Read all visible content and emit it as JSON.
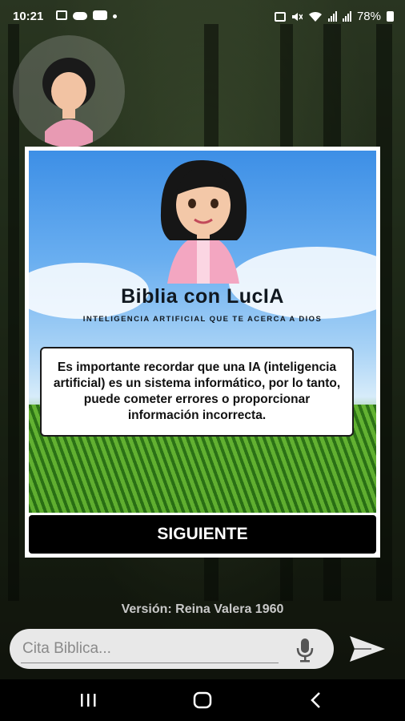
{
  "status_bar": {
    "time": "10:21",
    "battery": "78%",
    "left_icons": [
      "gallery-icon",
      "cloud-icon",
      "youtube-icon",
      "dot-icon"
    ],
    "right_icons": [
      "alarm-icon",
      "mute-icon",
      "wifi-icon",
      "signal-icon",
      "signal-icon-2",
      "battery-icon"
    ]
  },
  "modal": {
    "title": "Biblia con LucIA",
    "subtitle": "INTELIGENCIA ARTIFICIAL QUE TE ACERCA A DIOS",
    "notice": "Es importante recordar que una IA (inteligencia artificial) es un sistema informático, por lo tanto, puede cometer errores o proporcionar información incorrecta.",
    "next_label": "SIGUIENTE"
  },
  "version": "Versión: Reina Valera 1960",
  "search": {
    "placeholder": "Cita Biblica...",
    "value": ""
  },
  "colors": {
    "modal_button": "#000000",
    "input_bg": "#e8e8e8",
    "version_text": "#c9c9c9"
  }
}
